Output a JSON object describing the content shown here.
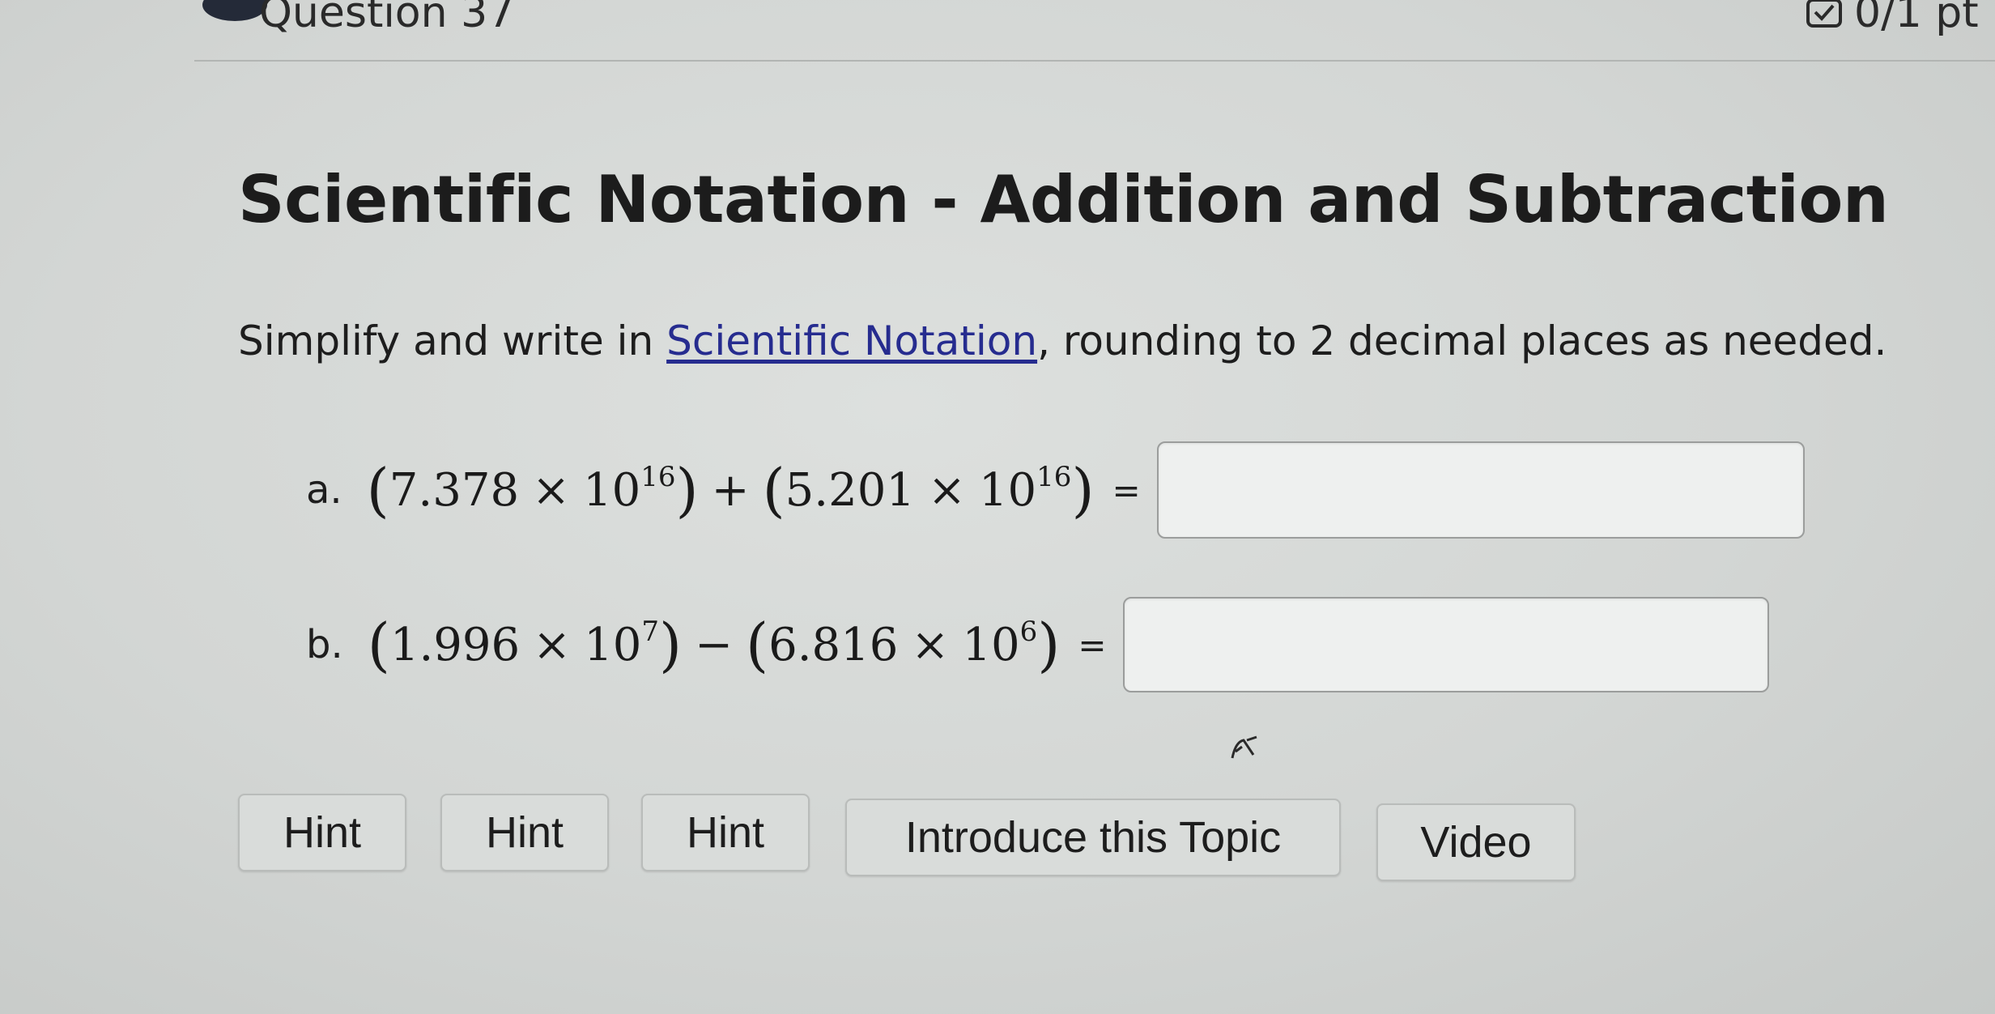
{
  "header": {
    "question_label": "Question 37",
    "points": "0/1 pt"
  },
  "title": "Scientific Notation - Addition and Subtraction",
  "instructions": {
    "before_link": "Simplify and write in ",
    "link_text": "Scientific Notation",
    "after_link": ", rounding to 2 decimal places as needed."
  },
  "problems": [
    {
      "label": "a.",
      "operand1_coef": "7.378",
      "operand1_base": "10",
      "operand1_exp": "16",
      "operator": "+",
      "operand2_coef": "5.201",
      "operand2_base": "10",
      "operand2_exp": "16",
      "times": "×",
      "equals": "=",
      "answer": ""
    },
    {
      "label": "b.",
      "operand1_coef": "1.996",
      "operand1_base": "10",
      "operand1_exp": "7",
      "operator": "−",
      "operand2_coef": "6.816",
      "operand2_base": "10",
      "operand2_exp": "6",
      "times": "×",
      "equals": "=",
      "answer": ""
    }
  ],
  "buttons": {
    "hint_1": "Hint",
    "hint_2": "Hint",
    "hint_3": "Hint",
    "introduce_topic": "Introduce this Topic",
    "video": "Video"
  },
  "icons": {
    "status": "status-dot-icon",
    "points": "checkbox-icon",
    "cursor": "pointer-cursor-icon"
  },
  "colors": {
    "link": "#262c8f",
    "status_dot": "#242a38",
    "button_bg": "#d9dcda"
  }
}
